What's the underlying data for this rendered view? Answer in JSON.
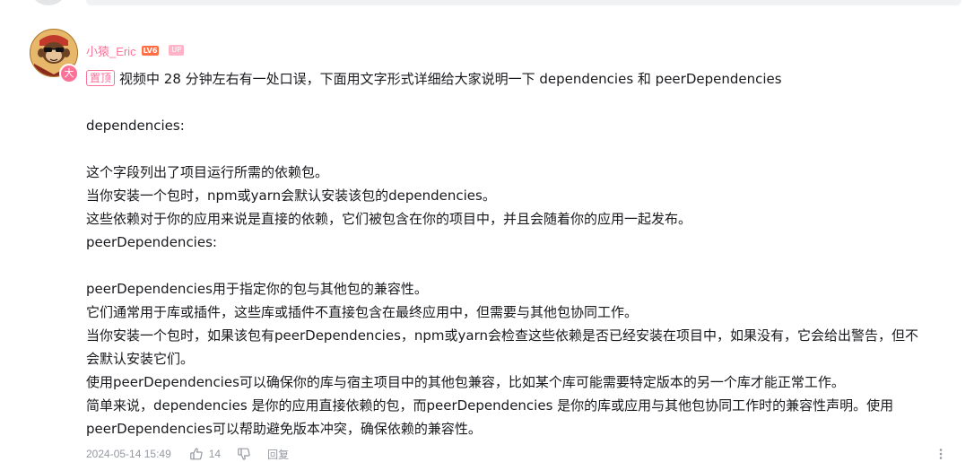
{
  "comment": {
    "username": "小猿_Eric",
    "level_badge": "LV6",
    "up_badge": "UP",
    "avatar_badge_char": "大",
    "pin_label": "置顶",
    "first_line": "视频中 28 分钟左右有一处口误，下面用文字形式详细给大家说明一下 dependencies 和 peerDependencies",
    "lines": [
      "",
      "dependencies:",
      "",
      "这个字段列出了项目运行所需的依赖包。",
      "当你安装一个包时，npm或yarn会默认安装该包的dependencies。",
      "这些依赖对于你的应用来说是直接的依赖，它们被包含在你的项目中，并且会随着你的应用一起发布。",
      "peerDependencies:",
      "",
      "peerDependencies用于指定你的包与其他包的兼容性。",
      "它们通常用于库或插件，这些库或插件不直接包含在最终应用中，但需要与其他包协同工作。",
      "当你安装一个包时，如果该包有peerDependencies，npm或yarn会检查这些依赖是否已经安装在项目中，如果没有，它会给出警告，但不",
      "会默认安装它们。",
      "使用peerDependencies可以确保你的库与宿主项目中的其他包兼容，比如某个库可能需要特定版本的另一个库才能正常工作。",
      "简单来说，dependencies 是你的应用直接依赖的包，而peerDependencies 是你的库或应用与其他包协同工作时的兼容性声明。使用",
      "peerDependencies可以帮助避免版本冲突，确保依赖的兼容性。"
    ],
    "date": "2024-05-14 15:49",
    "like_count": "14",
    "reply_label": "回复",
    "icons": {
      "like": "thumbs-up-icon",
      "dislike": "thumbs-down-icon",
      "more": "more-vertical-icon"
    },
    "colors": {
      "username": "#fb7299",
      "level_badge": "#ff6f45",
      "meta": "#9499a0",
      "text": "#18191c"
    }
  }
}
